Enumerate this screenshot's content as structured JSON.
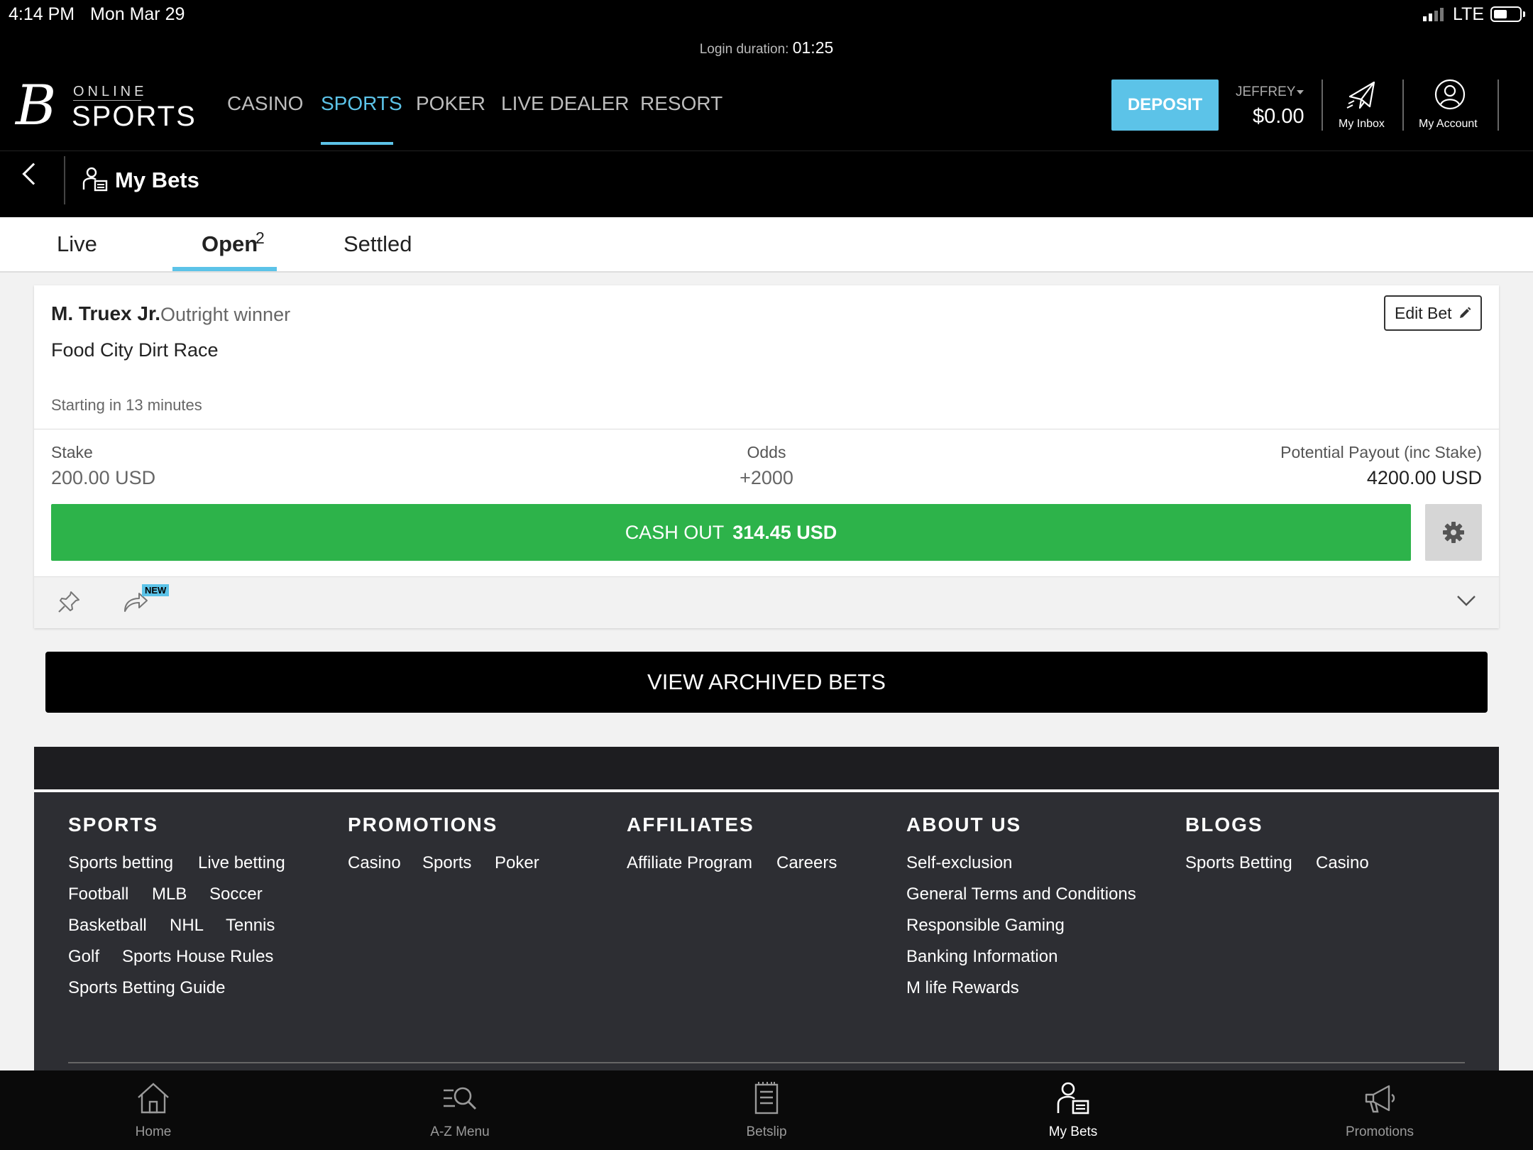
{
  "status_bar": {
    "time": "4:14 PM",
    "date": "Mon Mar 29",
    "network": "LTE"
  },
  "header": {
    "login_label": "Login duration:",
    "login_duration": "01:25",
    "logo": {
      "top": "ONLINE",
      "bottom": "SPORTS"
    },
    "nav": [
      "CASINO",
      "SPORTS",
      "POKER",
      "LIVE DEALER",
      "RESORT"
    ],
    "active_nav": "SPORTS",
    "deposit_label": "DEPOSIT",
    "username": "JEFFREY",
    "balance": "$0.00",
    "inbox_label": "My Inbox",
    "account_label": "My Account",
    "page_title": "My Bets",
    "accent_color": "#5cc3e8"
  },
  "tabs": {
    "live": "Live",
    "open": "Open",
    "open_count": "2",
    "settled": "Settled"
  },
  "bet": {
    "runner": "M. Truex Jr.",
    "market": "Outright winner",
    "event": "Food City Dirt Race",
    "starting": "Starting in 13 minutes",
    "edit_label": "Edit Bet",
    "stake_label": "Stake",
    "stake_value": "200.00 USD",
    "odds_label": "Odds",
    "odds_value": "+2000",
    "payout_label": "Potential Payout (inc Stake)",
    "payout_value": "4200.00 USD",
    "cashout_label": "CASH OUT",
    "cashout_value": "314.45 USD",
    "cashout_color": "#2db34a",
    "new_badge": "NEW"
  },
  "archived_label": "VIEW ARCHIVED BETS",
  "footer": {
    "sports": {
      "title": "SPORTS",
      "rows": [
        [
          "Sports betting",
          "Live betting"
        ],
        [
          "Football",
          "MLB",
          "Soccer"
        ],
        [
          "Basketball",
          "NHL",
          "Tennis"
        ],
        [
          "Golf",
          "Sports House Rules"
        ],
        [
          "Sports Betting Guide"
        ]
      ]
    },
    "promotions": {
      "title": "PROMOTIONS",
      "links": [
        "Casino",
        "Sports",
        "Poker"
      ]
    },
    "affiliates": {
      "title": "AFFILIATES",
      "links": [
        "Affiliate Program",
        "Careers"
      ]
    },
    "about": {
      "title": "ABOUT US",
      "links": [
        "Self-exclusion",
        "General Terms and Conditions",
        "Responsible Gaming",
        "Banking Information",
        "M life Rewards"
      ]
    },
    "blogs": {
      "title": "BLOGS",
      "links": [
        "Sports Betting",
        "Casino"
      ]
    }
  },
  "bottom_nav": {
    "home": "Home",
    "az": "A-Z Menu",
    "betslip": "Betslip",
    "mybets": "My Bets",
    "promotions": "Promotions",
    "active": "My Bets"
  }
}
